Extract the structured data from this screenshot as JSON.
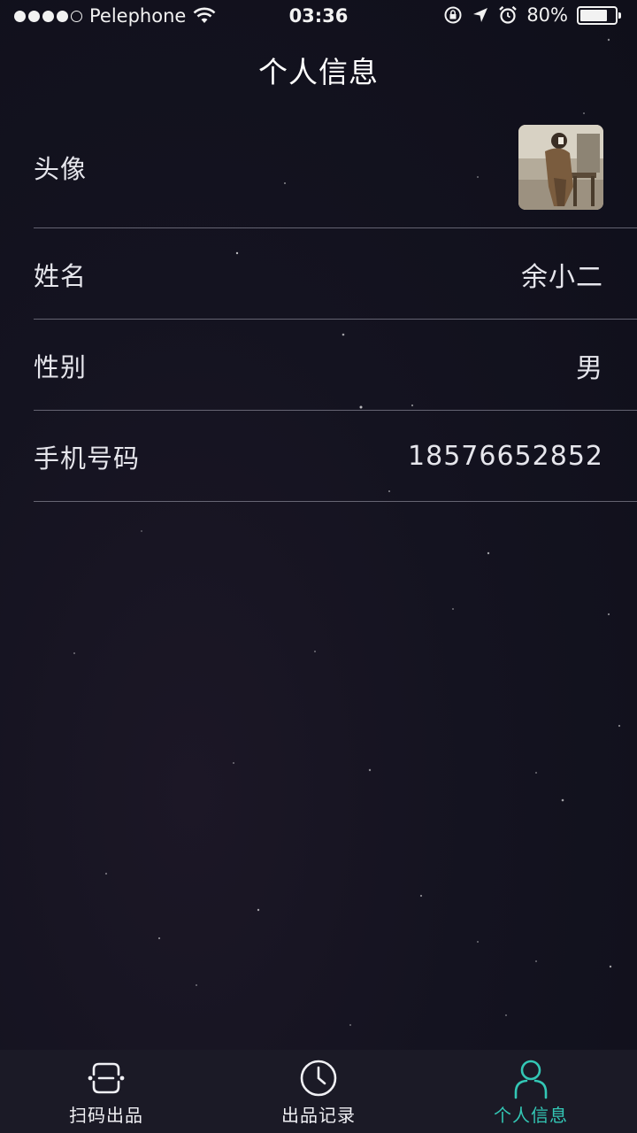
{
  "status_bar": {
    "carrier": "Pelephone",
    "time": "03:36",
    "battery_percent": "80%",
    "battery_level": 0.8
  },
  "header": {
    "title": "个人信息"
  },
  "profile": {
    "avatar_label": "头像",
    "name_label": "姓名",
    "name_value": "余小二",
    "gender_label": "性别",
    "gender_value": "男",
    "phone_label": "手机号码",
    "phone_value": "18576652852"
  },
  "tabs": [
    {
      "label": "扫码出品",
      "icon": "scan-icon",
      "active": false
    },
    {
      "label": "出品记录",
      "icon": "clock-icon",
      "active": false
    },
    {
      "label": "个人信息",
      "icon": "person-icon",
      "active": true
    }
  ],
  "colors": {
    "accent": "#33c7b5",
    "background": "#13121e",
    "tab_bar": "#1b1a26"
  }
}
